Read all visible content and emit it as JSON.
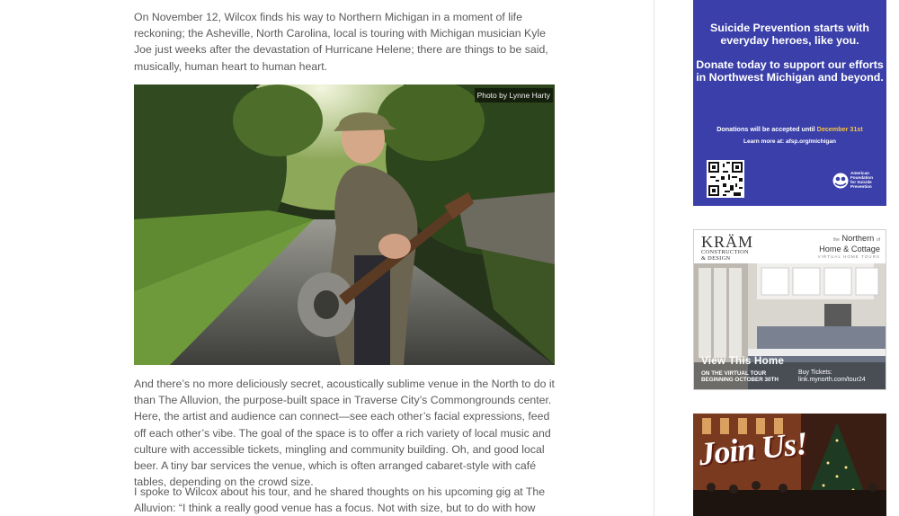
{
  "article": {
    "paragraphs": [
      "On November 12, Wilcox finds his way to Northern Michigan in a moment of life reckoning; the Asheville, North Carolina, local is touring with Michigan musician Kyle Joe just weeks after the devastation of Hurricane Helene; there are things to be said, musically, human heart to human heart.",
      "And there’s no more deliciously secret, acoustically sublime venue in the North to do it than The Alluvion, the purpose-built space in Traverse City’s Commongrounds center. Here, the artist and audience can connect—see each other’s facial expressions, feed off each other’s vibe. The goal of the space is to offer a rich variety of local music and culture with accessible tickets, mingling and community building. Oh, and good local beer. A tiny bar services the venue, which is often arranged cabaret-style with café tables, depending on the crowd size.",
      "I spoke to Wilcox about his tour, and he shared thoughts on his upcoming gig at The Alluvion: “I think a really good venue has a focus. Not with size, but to do with how focused the"
    ],
    "photo": {
      "credit": "Photo by Lynne Harty",
      "subject": "man-with-resonator-guitar-on-road"
    }
  },
  "sidebar": {
    "afsp_ad": {
      "headline": "Suicide Prevention starts with everyday heroes, like you.",
      "donate": "Donate today to support our efforts in Northwest Michigan and beyond.",
      "accepted_prefix": "Donations will be accepted until ",
      "accepted_date": "December 31st",
      "learn_more": "Learn more at: afsp.org/michigan",
      "logo_lines": [
        "American",
        "Foundation",
        "for Suicide",
        "Prevention"
      ],
      "bg_color": "#3a3fa9"
    },
    "kram_ad": {
      "brand": "KRÄM",
      "brand_sub_1": "CONSTRUCTION",
      "brand_sub_2": "& DESIGN",
      "partner_the": "the",
      "partner_name_1": "Northern",
      "partner_of": "of",
      "partner_name_2": "Home & Cottage",
      "partner_sub": "VIRTUAL HOME TOURS",
      "view": "View This Home",
      "tour_line_1": "ON THE VIRTUAL TOUR",
      "tour_line_2": "BEGINNING OCTOBER 30TH",
      "tickets_line_1": "Buy Tickets:",
      "tickets_line_2": "link.mynorth.com/tour24"
    },
    "join_ad": {
      "text": "Join Us!"
    }
  }
}
